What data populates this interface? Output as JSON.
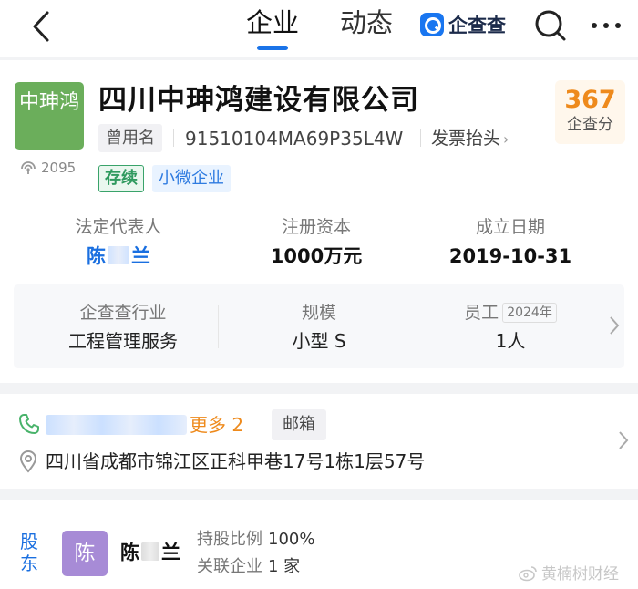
{
  "nav": {
    "tab_company": "企业",
    "tab_news": "动态",
    "brand": "企查查"
  },
  "company": {
    "logo_text": "中珅鸿",
    "views": "2095",
    "name": "四川中珅鸿建设有限公司",
    "former_name_label": "曾用名",
    "credit_code": "91510104MA69P35L4W",
    "invoice_label": "发票抬头",
    "status_tag": "存续",
    "size_tag": "小微企业",
    "score": "367",
    "score_label": "企查分"
  },
  "basics": {
    "legal_rep_label": "法定代表人",
    "legal_rep_first": "陈",
    "legal_rep_last": "兰",
    "capital_label": "注册资本",
    "capital": "1000万元",
    "founded_label": "成立日期",
    "founded": "2019-10-31"
  },
  "industry": {
    "industry_label": "企查查行业",
    "industry": "工程管理服务",
    "scale_label": "规模",
    "scale": "小型 S",
    "staff_label": "员工",
    "staff_year": "2024年",
    "staff": "1人"
  },
  "contact": {
    "more_phones": "更多 2",
    "email_label": "邮箱",
    "address": "四川省成都市锦江区正科甲巷17号1栋1层57号"
  },
  "shareholder": {
    "section_label": "股东",
    "avatar_text": "陈",
    "name_first": "陈",
    "name_last": "兰",
    "ratio_label": "持股比例",
    "ratio": "100%",
    "linked_label": "关联企业",
    "linked": "1 家"
  },
  "watermark": "黄楠树财经",
  "colors": {
    "primary_blue": "#1a73e8",
    "score_orange": "#ee8a1c",
    "status_green": "#2f9a5e",
    "logo_green": "#6bae5b",
    "avatar_purple": "#a78bd6"
  }
}
